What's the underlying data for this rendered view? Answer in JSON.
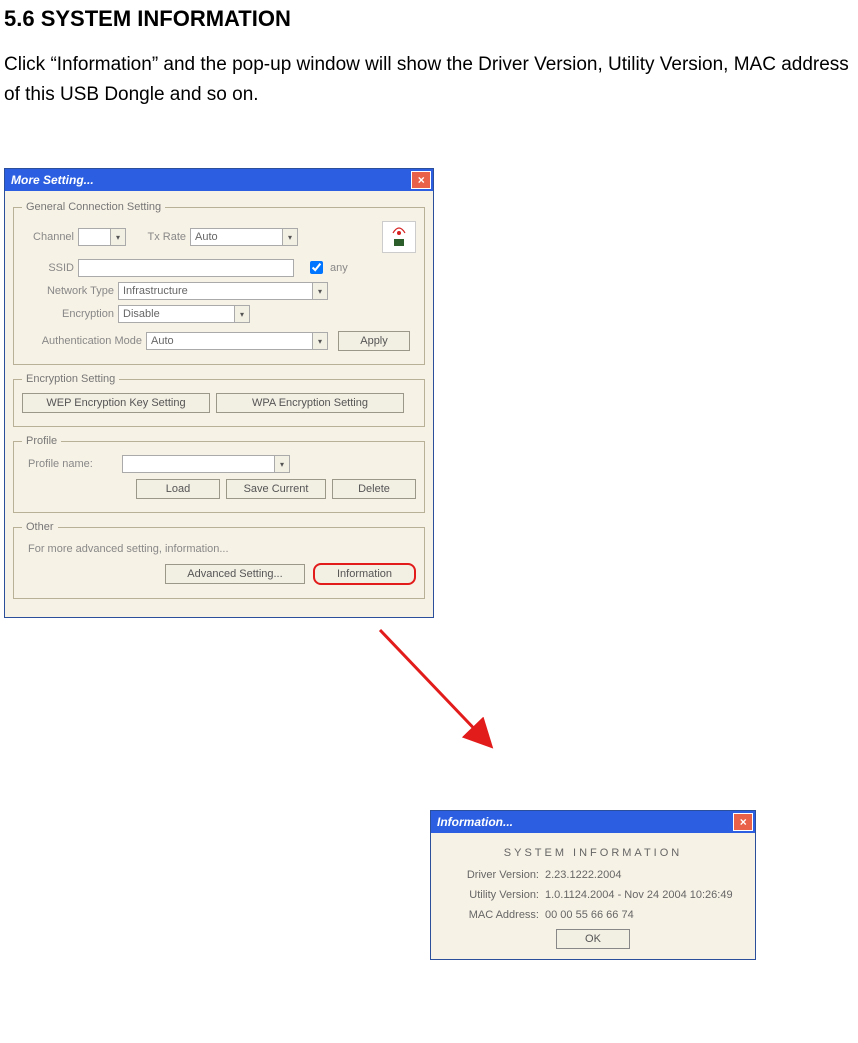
{
  "heading": "5.6 SYSTEM INFORMATION",
  "intro": "Click “Information” and the pop-up window will show the Driver Version, Utility Version, MAC address of this USB Dongle and so on.",
  "win1": {
    "title": "More Setting...",
    "close": "×",
    "groups": {
      "general": {
        "legend": "General Connection Setting",
        "channel_label": "Channel",
        "channel_value": "",
        "txrate_label": "Tx Rate",
        "txrate_value": "Auto",
        "ssid_label": "SSID",
        "ssid_value": "",
        "any_label": "any",
        "nettype_label": "Network Type",
        "nettype_value": "Infrastructure",
        "encryption_label": "Encryption",
        "encryption_value": "Disable",
        "auth_label": "Authentication Mode",
        "auth_value": "Auto",
        "apply_btn": "Apply"
      },
      "enc": {
        "legend": "Encryption Setting",
        "wep_btn": "WEP Encryption Key Setting",
        "wpa_btn": "WPA Encryption Setting"
      },
      "profile": {
        "legend": "Profile",
        "name_label": "Profile name:",
        "name_value": "",
        "load_btn": "Load",
        "save_btn": "Save Current",
        "delete_btn": "Delete"
      },
      "other": {
        "legend": "Other",
        "desc": "For more advanced setting, information...",
        "adv_btn": "Advanced Setting...",
        "info_btn": "Information"
      }
    }
  },
  "win2": {
    "title": "Information...",
    "close": "×",
    "sys_title": "SYSTEM INFORMATION",
    "rows": {
      "driver_label": "Driver Version:",
      "driver_value": "2.23.1222.2004",
      "utility_label": "Utility Version:",
      "utility_value": "1.0.1124.2004 - Nov 24 2004 10:26:49",
      "mac_label": "MAC Address:",
      "mac_value": "00 00 55 66 66 74"
    },
    "ok_btn": "OK"
  }
}
